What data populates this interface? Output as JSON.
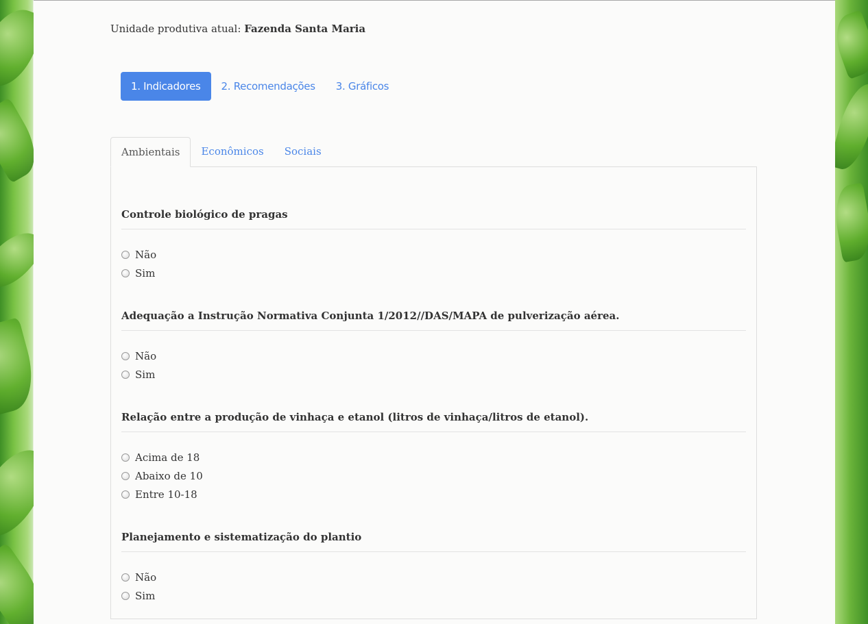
{
  "header": {
    "unit_label": "Unidade produtiva atual:",
    "unit_name": "Fazenda Santa Maria"
  },
  "steps": [
    {
      "label": "1. Indicadores",
      "active": true
    },
    {
      "label": "2. Recomendações",
      "active": false
    },
    {
      "label": "3. Gráficos",
      "active": false
    }
  ],
  "tabs": [
    {
      "label": "Ambientais",
      "active": true
    },
    {
      "label": "Econômicos",
      "active": false
    },
    {
      "label": "Sociais",
      "active": false
    }
  ],
  "questions": [
    {
      "title": "Controle biológico de pragas",
      "options": [
        "Não",
        "Sim"
      ]
    },
    {
      "title": "Adequação a Instrução Normativa Conjunta 1/2012//DAS/MAPA de pulverização aérea.",
      "options": [
        "Não",
        "Sim"
      ]
    },
    {
      "title": "Relação entre a produção de vinhaça e etanol (litros de vinhaça/litros de etanol).",
      "options": [
        "Acima de 18",
        "Abaixo de 10",
        "Entre 10-18"
      ]
    },
    {
      "title": "Planejamento e sistematização do plantio",
      "options": [
        "Não",
        "Sim"
      ]
    }
  ],
  "colors": {
    "accent": "#4a86e8",
    "text": "#333333",
    "border": "#dddddd"
  }
}
